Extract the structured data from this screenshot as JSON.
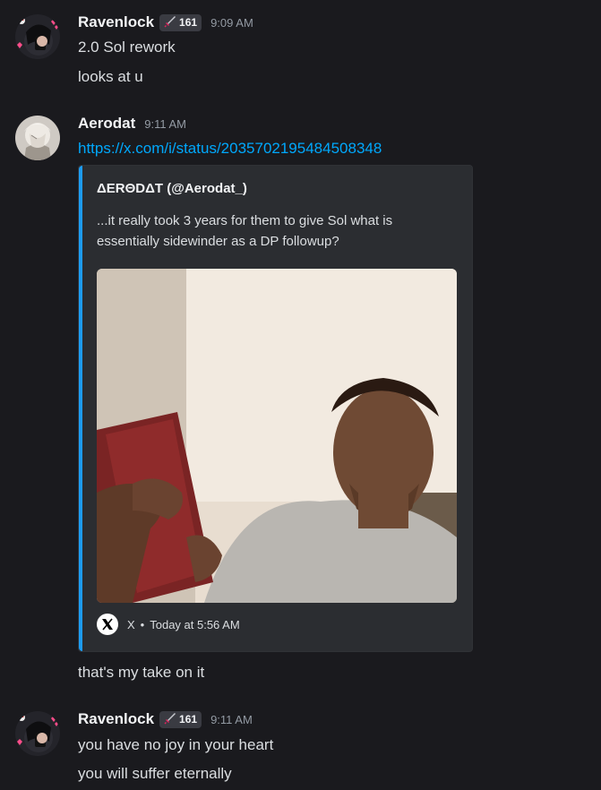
{
  "messages": [
    {
      "author": "Ravenlock",
      "badge": "161",
      "time": "9:09 AM",
      "lines": [
        "2.0 Sol rework",
        "looks at u"
      ]
    },
    {
      "author": "Aerodat",
      "time": "9:11 AM",
      "link": "https://x.com/i/status/2035702195484508348",
      "embed": {
        "author": "ΔERΘDΔT (@Aerodat_)",
        "description": "...it really took 3 years for them to give Sol what is essentially sidewinder as a DP followup?",
        "footer_site": "X",
        "footer_time": "Today at 5:56 AM"
      },
      "after": "that's my take on it"
    },
    {
      "author": "Ravenlock",
      "badge": "161",
      "time": "9:11 AM",
      "lines": [
        "you have no joy in your heart",
        "you will suffer eternally"
      ]
    }
  ],
  "colors": {
    "background": "#1a1a1e",
    "link": "#00a8fc",
    "embed_accent": "#1d9bf0",
    "embed_bg": "#2b2d31"
  },
  "icons": [
    "sword-icon",
    "x-logo-icon"
  ]
}
